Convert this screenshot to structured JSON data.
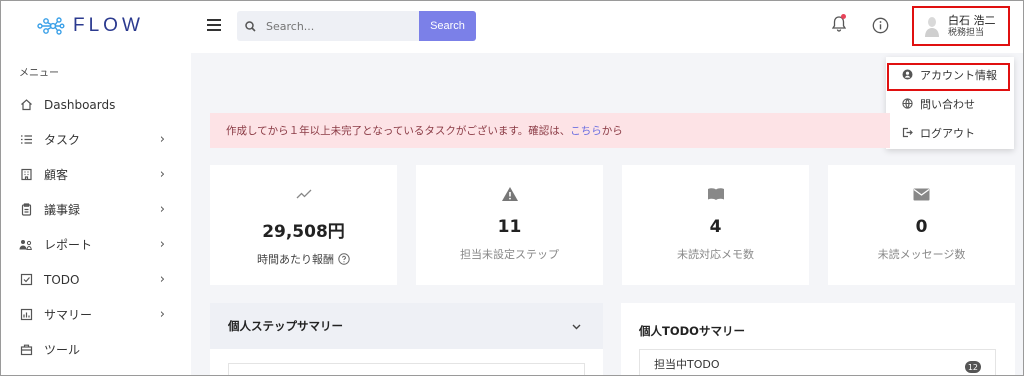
{
  "app": {
    "logo_text": "FLOW"
  },
  "sidebar": {
    "caption": "メニュー",
    "items": [
      {
        "label": "Dashboards",
        "icon": "home-icon",
        "has_children": false
      },
      {
        "label": "タスク",
        "icon": "list-icon",
        "has_children": true
      },
      {
        "label": "顧客",
        "icon": "building-icon",
        "has_children": true
      },
      {
        "label": "議事録",
        "icon": "clipboard-icon",
        "has_children": true
      },
      {
        "label": "レポート",
        "icon": "users-icon",
        "has_children": true
      },
      {
        "label": "TODO",
        "icon": "checkbox-icon",
        "has_children": true
      },
      {
        "label": "サマリー",
        "icon": "bar-chart-icon",
        "has_children": true
      },
      {
        "label": "ツール",
        "icon": "toolbox-icon",
        "has_children": false
      }
    ]
  },
  "header": {
    "search_placeholder": "Search...",
    "search_button": "Search",
    "user": {
      "name": "白石 浩二",
      "role": "税務担当"
    }
  },
  "user_menu": {
    "items": [
      {
        "label": "アカウント情報",
        "icon": "user-circle-icon",
        "highlighted": true
      },
      {
        "label": "問い合わせ",
        "icon": "globe-icon",
        "highlighted": false
      },
      {
        "label": "ログアウト",
        "icon": "logout-icon",
        "highlighted": false
      }
    ]
  },
  "alert": {
    "text_before": "作成してから１年以上未完了となっているタスクがございます。確認は、",
    "link": "こちら",
    "text_after": "から"
  },
  "stats": [
    {
      "value": "29,508円",
      "label": "時間あたり報酬",
      "icon": "trend-icon"
    },
    {
      "value": "11",
      "label": "担当未設定ステップ",
      "icon": "warning-icon"
    },
    {
      "value": "4",
      "label": "未読対応メモ数",
      "icon": "book-icon"
    },
    {
      "value": "0",
      "label": "未読メッセージ数",
      "icon": "mail-icon"
    }
  ],
  "panels": {
    "steps_title": "個人ステップサマリー",
    "todo_title": "個人TODOサマリー",
    "todo_row_label": "担当中TODO",
    "todo_row_count": "12"
  },
  "colors": {
    "accent": "#7b80e8",
    "alert_bg": "#fde3e6",
    "highlight_border": "#e01010",
    "logo": "#2b3a8f"
  }
}
